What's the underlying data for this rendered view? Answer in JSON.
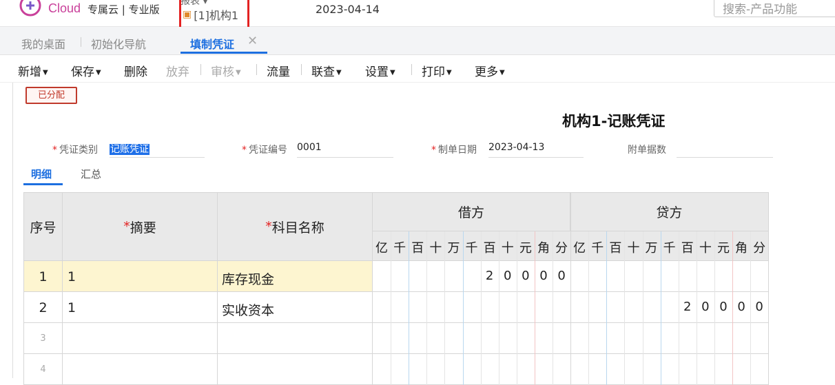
{
  "header": {
    "brand": "Cloud",
    "plan": "专属云 | 专业版",
    "report_menu": "报表",
    "org": "[1]机构1",
    "date": "2023-04-14",
    "search_placeholder": "搜索-产品功能",
    "colors": {
      "brand": "#c9409a",
      "highlight_box": "#e32222"
    }
  },
  "tabs": [
    {
      "label": "我的桌面"
    },
    {
      "label": "初始化导航"
    },
    {
      "label": "填制凭证",
      "active": true
    }
  ],
  "toolbar": [
    {
      "label": "新增",
      "dropdown": true,
      "disabled": false
    },
    {
      "label": "保存",
      "dropdown": true,
      "disabled": false
    },
    {
      "label": "删除",
      "dropdown": false,
      "disabled": false
    },
    {
      "label": "放弃",
      "dropdown": false,
      "disabled": true
    },
    {
      "label": "审核",
      "dropdown": true,
      "disabled": true
    },
    {
      "label": "流量",
      "dropdown": false,
      "disabled": false
    },
    {
      "label": "联查",
      "dropdown": true,
      "disabled": false
    },
    {
      "label": "设置",
      "dropdown": true,
      "disabled": false
    },
    {
      "label": "打印",
      "dropdown": true,
      "disabled": false
    },
    {
      "label": "更多",
      "dropdown": true,
      "disabled": false
    }
  ],
  "voucher": {
    "status_stamp": "已分配",
    "title": "机构1-记账凭证",
    "fields": {
      "category_label": "凭证类别",
      "category_value": "记账凭证",
      "number_label": "凭证编号",
      "number_value": "0001",
      "date_label": "制单日期",
      "date_value": "2023-04-13",
      "attach_label": "附单据数",
      "attach_value": ""
    },
    "sub_tabs": [
      "明细",
      "汇总"
    ]
  },
  "grid": {
    "headers": {
      "seq": "序号",
      "summary": "摘要",
      "account": "科目名称",
      "debit": "借方",
      "credit": "贷方",
      "digits": [
        "亿",
        "千",
        "百",
        "十",
        "万",
        "千",
        "百",
        "十",
        "元",
        "角",
        "分"
      ]
    },
    "rows": [
      {
        "seq": "1",
        "summary": "1",
        "account": "库存现金",
        "debit": "20000",
        "credit": ""
      },
      {
        "seq": "2",
        "summary": "1",
        "account": "实收资本",
        "debit": "",
        "credit": "20000"
      },
      {
        "seq": "3",
        "summary": "",
        "account": "",
        "debit": "",
        "credit": ""
      },
      {
        "seq": "4",
        "summary": "",
        "account": "",
        "debit": "",
        "credit": ""
      }
    ]
  }
}
